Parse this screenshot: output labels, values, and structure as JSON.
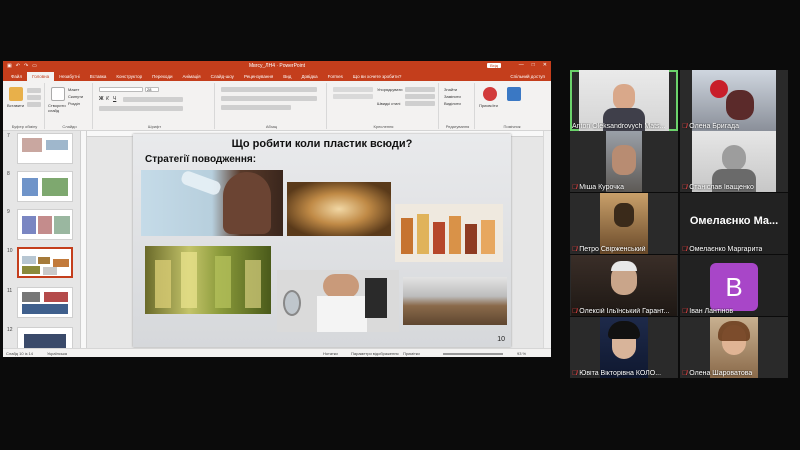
{
  "app": {
    "doc_title": "Мвгсу_ЛН4 · PowerPoint",
    "sign_in": "Вхід",
    "window_controls": [
      "—",
      "□",
      "✕"
    ]
  },
  "ribbon_tabs": [
    {
      "label": "Файл"
    },
    {
      "label": "Головна"
    },
    {
      "label": "Незабутні"
    },
    {
      "label": "Вставка"
    },
    {
      "label": "Конструктор"
    },
    {
      "label": "Переходи"
    },
    {
      "label": "Анімація"
    },
    {
      "label": "Слайд-шоу"
    },
    {
      "label": "Рецензування"
    },
    {
      "label": "Вид"
    },
    {
      "label": "Довідка"
    },
    {
      "label": "Formes"
    },
    {
      "label": "Що ви хочете зробити?"
    }
  ],
  "share_label": "Спільний доступ",
  "ribbon_groups": [
    {
      "label": "Буфер обміну"
    },
    {
      "label": "Слайди"
    },
    {
      "label": "Шрифт"
    },
    {
      "label": "Абзац"
    },
    {
      "label": "Креслення"
    },
    {
      "label": "Редагування"
    },
    {
      "label": "Помічник"
    }
  ],
  "ribbon_buttons": {
    "paste": "Вставити",
    "new_slide": "Створити слайд",
    "layout": "Макет",
    "reset": "Скинути",
    "section": "Розділ",
    "arrange": "Упорядкувати",
    "quick_styles": "Швидкі стилі",
    "find": "Знайти",
    "replace": "Замінити",
    "select": "Виділити",
    "present": "Присвоїти",
    "font_size": "28"
  },
  "thumbnails": [
    {
      "num": "7"
    },
    {
      "num": "8"
    },
    {
      "num": "9"
    },
    {
      "num": "10"
    },
    {
      "num": "11"
    },
    {
      "num": "12"
    }
  ],
  "slide": {
    "title": "Що робити коли пластик всюди?",
    "subtitle": "Стратегії поводження:",
    "number": "10"
  },
  "statusbar": {
    "slide_info": "Слайд 10 із 14",
    "language": "Українська",
    "notes": "Нотатки",
    "display_settings": "Параметри відображення",
    "comments": "Примітки",
    "zoom": "93 %"
  },
  "participants": [
    {
      "name": "Anton Oleksandrovych Mats...",
      "muted": false,
      "active": true
    },
    {
      "name": "Олена Бригада",
      "muted": true
    },
    {
      "name": "Міша Курочка",
      "muted": true
    },
    {
      "name": "Станіслав Іващенко",
      "muted": true
    },
    {
      "name": "Петро Свірженський",
      "muted": true
    },
    {
      "name": "Омелаєнко Маргарита",
      "muted": true,
      "display": "Омелаєнко  Ма..."
    },
    {
      "name": "Олексій Ільїнський Гарант...",
      "muted": true
    },
    {
      "name": "Іван Лантінов",
      "muted": true,
      "avatar": "B"
    },
    {
      "name": "Ювіта Вікторівна КОЛО...",
      "muted": true
    },
    {
      "name": "Олена Шароватова",
      "muted": true
    }
  ]
}
